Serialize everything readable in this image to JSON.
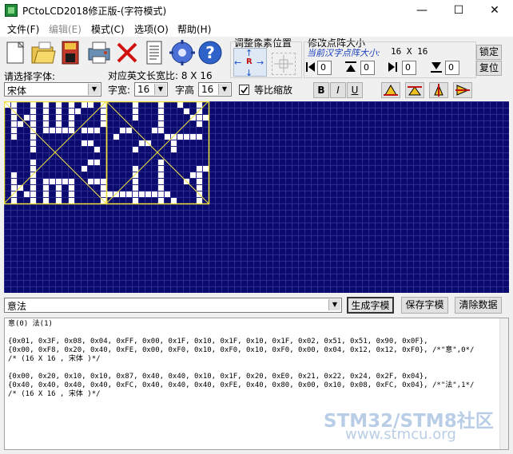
{
  "window": {
    "title": "PCtoLCD2018修正版-(字符模式)",
    "minimize_label": "—",
    "maximize_label": "☐",
    "close_label": "✕"
  },
  "menu": {
    "items": [
      {
        "label": "文件(F)"
      },
      {
        "label": "编辑(E)"
      },
      {
        "label": "模式(C)"
      },
      {
        "label": "选项(O)"
      },
      {
        "label": "帮助(H)"
      }
    ]
  },
  "toolbar": {
    "icons": [
      "new-file-icon",
      "open-folder-icon",
      "save-disk-icon",
      "print-icon",
      "delete-icon",
      "notes-icon",
      "settings-gear-icon",
      "help-icon"
    ],
    "adjust_group_label": "调整像素位置",
    "arrow_up": "↑",
    "arrow_down": "↓",
    "arrow_left": "←",
    "arrow_right": "→",
    "center_label": "R",
    "dot_group_label": "修改点阵大小",
    "current_size_label": "当前汉字点阵大小:",
    "current_size_value": "16 X 16",
    "lock_label": "锁定",
    "reset_label": "复位",
    "spin_values": [
      "0",
      "0",
      "0",
      "0"
    ]
  },
  "font_row": {
    "select_font_label": "请选择字体:",
    "ratio_label": "对应英文长宽比: 8 X 16",
    "font_value": "宋体",
    "width_label": "字宽:",
    "width_value": "16",
    "height_label": "字高",
    "height_value": "16",
    "scale_label": "等比缩放",
    "bold_label": "B",
    "italic_label": "I",
    "underline_label": "U"
  },
  "bottom": {
    "text_input_value": "意法",
    "generate_label": "生成字模",
    "save_label": "保存字模",
    "clear_label": "清除数据"
  },
  "output": {
    "lines": [
      " 意(0) 法(1)",
      "",
      "{0x01, 0x3F, 0x08, 0x04, 0xFF, 0x00, 0x1F, 0x10, 0x1F, 0x10, 0x1F, 0x02, 0x51, 0x51, 0x90, 0x0F},",
      "{0x00, 0xF8, 0x20, 0x40, 0xFE, 0x00, 0xF0, 0x10, 0xF0, 0x10, 0xF0, 0x00, 0x04, 0x12, 0x12, 0xF0}, /*\"意\",0*/",
      "/* (16 X 16 , 宋体 )*/",
      "",
      "{0x00, 0x20, 0x10, 0x10, 0x87, 0x40, 0x40, 0x10, 0x1F, 0x20, 0xE0, 0x21, 0x22, 0x24, 0x2F, 0x04},",
      "{0x40, 0x40, 0x40, 0x40, 0xFC, 0x40, 0x40, 0x40, 0xFE, 0x40, 0x80, 0x00, 0x10, 0x08, 0xFC, 0x04}, /*\"法\",1*/",
      "/* (16 X 16 , 宋体 )*/"
    ]
  },
  "watermark": {
    "line1": "STM32/STM8社区",
    "line2": "www.stmcu.org"
  },
  "colors": {
    "grid_bg": "#0a0a6e",
    "grid_line": "#2a2a8a",
    "pixel_on": "#ffffff",
    "guide": "#f0e040"
  }
}
